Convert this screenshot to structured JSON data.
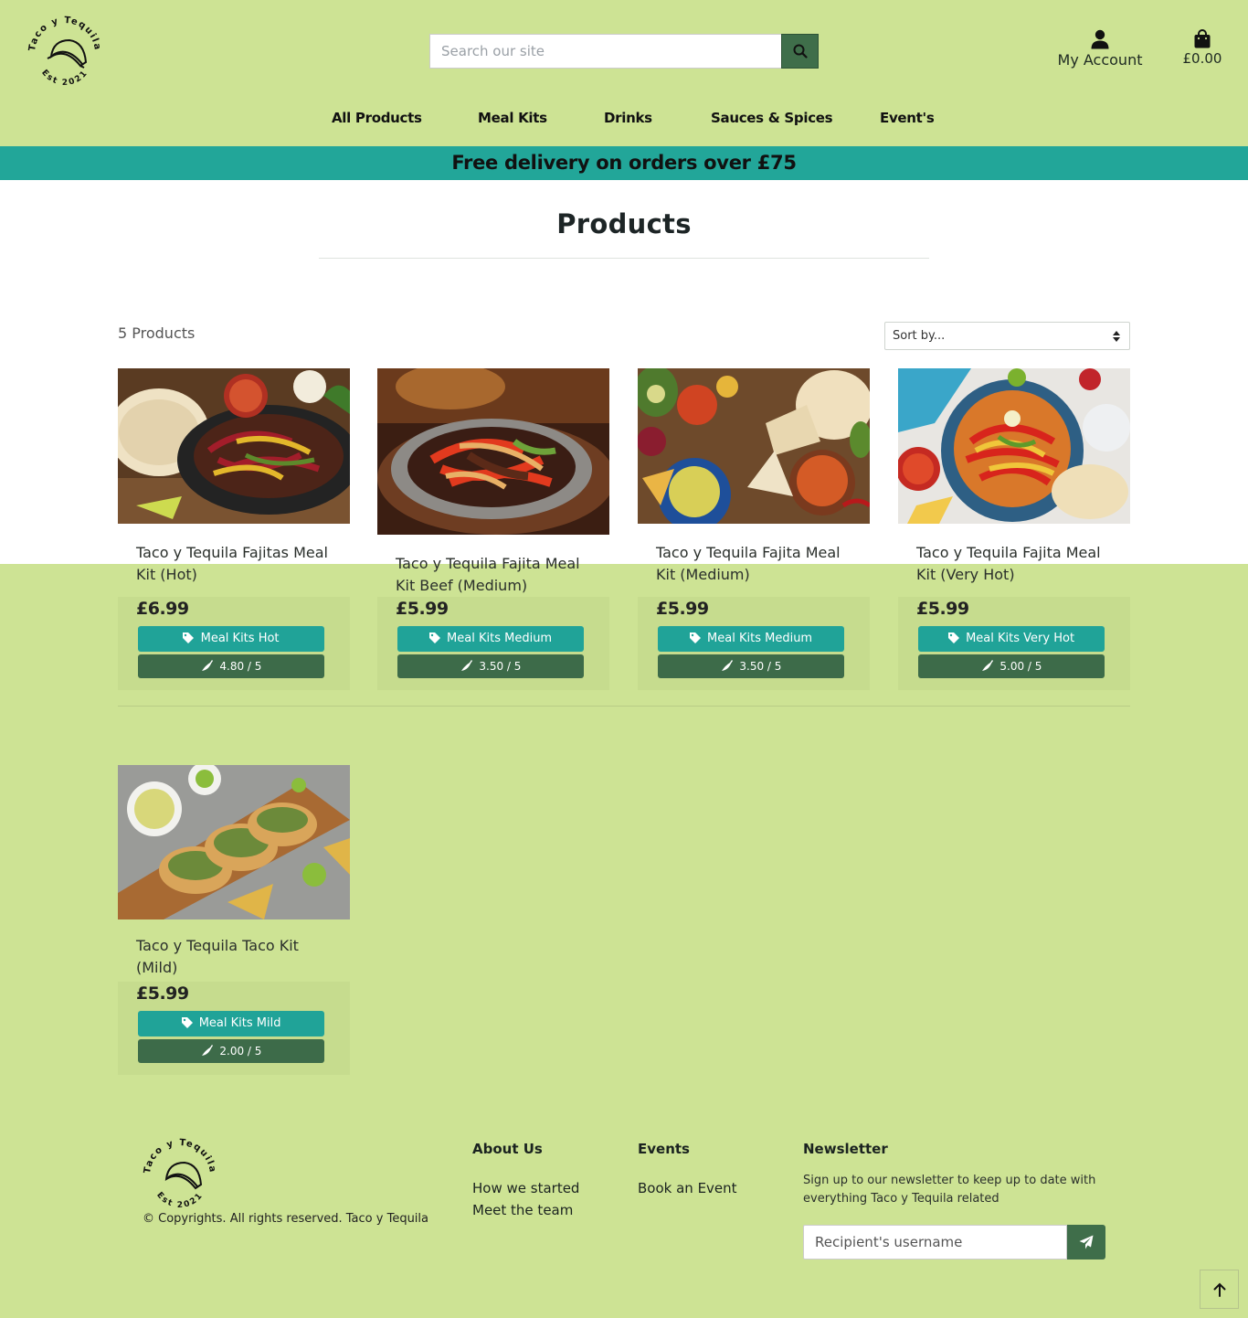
{
  "brand": {
    "logo_text_top": "Taco y Tequila",
    "logo_text_bottom": "Est 2021"
  },
  "header": {
    "search_placeholder": "Search our site",
    "account_label": "My Account",
    "cart_total": "£0.00",
    "icons": {
      "search": "search-icon",
      "account": "user-icon",
      "cart": "shopping-bag-icon"
    }
  },
  "nav": {
    "items": [
      "All Products",
      "Meal Kits",
      "Drinks",
      "Sauces & Spices",
      "Event's"
    ]
  },
  "promo_banner": "Free delivery on orders over £75",
  "main": {
    "title": "Products",
    "product_count": "5 Products",
    "sort_label": "Sort by..."
  },
  "products": [
    {
      "name": "Taco y Tequila Fajitas Meal Kit (Hot)",
      "price": "£6.99",
      "category": "Meal Kits Hot",
      "rating": "4.80 / 5",
      "image": "fajitas-skillet-image"
    },
    {
      "name": "Taco y Tequila Fajita Meal Kit Beef (Medium)",
      "price": "£5.99",
      "category": "Meal Kits Medium",
      "rating": "3.50 / 5",
      "image": "beef-fajita-image"
    },
    {
      "name": "Taco y Tequila Fajita Meal Kit (Medium)",
      "price": "£5.99",
      "category": "Meal Kits Medium",
      "rating": "3.50 / 5",
      "image": "fajita-spread-image"
    },
    {
      "name": "Taco y Tequila Fajita Meal Kit (Very Hot)",
      "price": "£5.99",
      "category": "Meal Kits Very Hot",
      "rating": "5.00 / 5",
      "image": "fajita-pan-image"
    },
    {
      "name": "Taco y Tequila Taco Kit (Mild)",
      "price": "£5.99",
      "category": "Meal Kits Mild",
      "rating": "2.00 / 5",
      "image": "tacos-board-image"
    }
  ],
  "footer": {
    "copyright": "© Copyrights. All rights reserved. Taco y Tequila",
    "about": {
      "title": "About Us",
      "links": [
        "How we started",
        "Meet the team"
      ]
    },
    "events": {
      "title": "Events",
      "links": [
        "Book an Event"
      ]
    },
    "newsletter": {
      "title": "Newsletter",
      "text": "Sign up to our newsletter to keep up to date with everything Taco y Tequila related",
      "placeholder": "Recipient's username"
    }
  },
  "colors": {
    "page_bg": "#cde394",
    "teal": "#22a699",
    "dark_green": "#3d6b49",
    "card_footer": "#c6dc8e"
  }
}
